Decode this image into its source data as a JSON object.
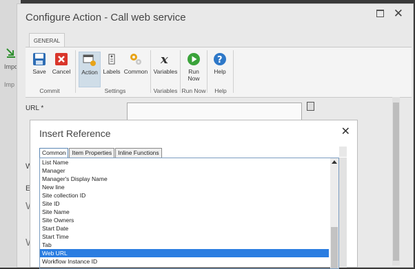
{
  "background": {
    "left_label": "Impo",
    "left_label2": "Imp"
  },
  "dialog": {
    "title": "Configure Action - Call web service",
    "close_glyph": "✕"
  },
  "ribbon": {
    "tab": "GENERAL",
    "buttons": {
      "save": "Save",
      "cancel": "Cancel",
      "action": "Action",
      "labels": "Labels",
      "common": "Common",
      "variables": "Variables",
      "run_now": "Run Now",
      "help": "Help"
    },
    "groups": {
      "commit": "Commit",
      "settings": "Settings",
      "variables": "Variables",
      "run_now": "Run Now",
      "help": "Help"
    }
  },
  "form": {
    "url_label": "URL *",
    "w1": "W",
    "e": "E",
    "w2": "W",
    "w3": "W"
  },
  "insert_reference": {
    "title": "Insert Reference",
    "close_glyph": "✕",
    "tabs": [
      "Common",
      "Item Properties",
      "Inline Functions"
    ],
    "items": [
      "List Name",
      "Manager",
      "Manager's Display Name",
      "New line",
      "Site collection ID",
      "Site ID",
      "Site Name",
      "Site Owners",
      "Start Date",
      "Start Time",
      "Tab",
      "Web URL",
      "Workflow Instance ID"
    ],
    "selected": "Web URL"
  }
}
